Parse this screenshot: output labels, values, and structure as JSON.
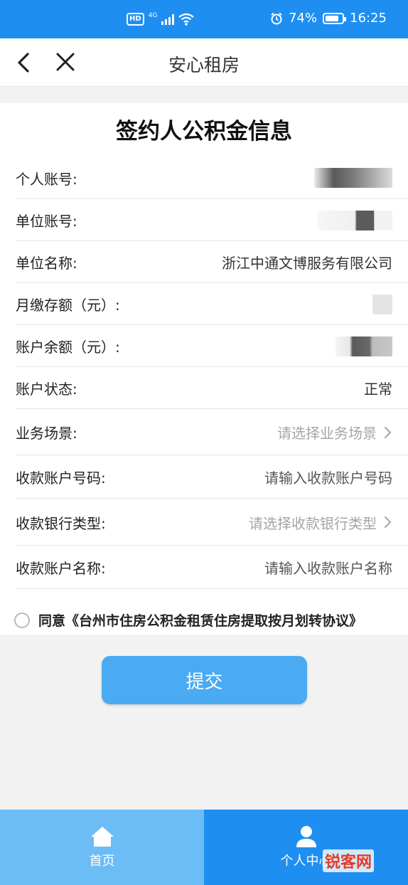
{
  "status_bar": {
    "left_badge": "HD",
    "network": "4G",
    "battery": "74%",
    "time": "16:25"
  },
  "navbar": {
    "title": "安心租房"
  },
  "form": {
    "title": "签约人公积金信息",
    "rows": [
      {
        "label": "个人账号:",
        "value": ""
      },
      {
        "label": "单位账号:",
        "value": ""
      },
      {
        "label": "单位名称:",
        "value": "浙江中通文博服务有限公司"
      },
      {
        "label": "月缴存额（元）:",
        "value": ""
      },
      {
        "label": "账户余额（元）:",
        "value": ""
      },
      {
        "label": "账户状态:",
        "value": "正常"
      },
      {
        "label": "业务场景:",
        "value": "请选择业务场景"
      },
      {
        "label": "收款账户号码:",
        "value": "请输入收款账户号码"
      },
      {
        "label": "收款银行类型:",
        "value": "请选择收款银行类型"
      },
      {
        "label": "收款账户名称:",
        "value": "请输入收款账户名称"
      }
    ],
    "agreement": "同意《台州市住房公积金租赁住房提取按月划转协议》",
    "submit_label": "提交"
  },
  "tabbar": {
    "home_label": "首页",
    "me_label": "个人中心"
  },
  "watermark": "锐客网",
  "colors": {
    "primary": "#1e8ff0",
    "submit": "#4aaaf2",
    "placeholder": "#a5a5a5"
  }
}
